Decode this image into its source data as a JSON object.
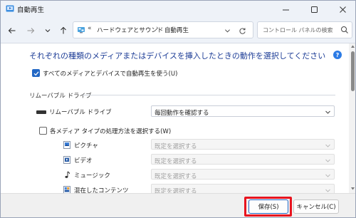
{
  "window": {
    "title": "自動再生",
    "controls": {
      "minimize_icon": "minimize-icon",
      "maximize_icon": "maximize-icon",
      "close_icon": "close-icon"
    }
  },
  "nav": {
    "back_icon": "arrow-left-icon",
    "forward_icon": "arrow-right-icon",
    "recent_icon": "chevron-down-icon",
    "up_icon": "arrow-up-icon",
    "address": {
      "separator": "«",
      "crumbs": [
        "ハードウェアとサウンド",
        "自動再生"
      ],
      "crumb_separator": "›"
    },
    "search": {
      "placeholder": "コントロール パネルの検索"
    }
  },
  "main": {
    "heading": "それぞれの種類のメディアまたはデバイスを挿入したときの動作を選択してください",
    "use_autoplay": {
      "label": "すべてのメディアとデバイスで自動再生を使う(U)",
      "checked": true
    },
    "removable_section": {
      "title": "リムーバブル ドライブ",
      "item_label": "リムーバブル ドライブ",
      "selected": "毎回動作を確認する"
    },
    "per_media": {
      "label": "各メディア タイプの処理方法を選択する(W)",
      "checked": false
    },
    "media_types": [
      {
        "label": "ピクチャ",
        "icon": "picture-icon",
        "selected": "既定を選択する"
      },
      {
        "label": "ビデオ",
        "icon": "video-icon",
        "selected": "既定を選択する"
      },
      {
        "label": "ミュージック",
        "icon": "music-icon",
        "selected": "既定を選択する"
      },
      {
        "label": "混在したコンテンツ",
        "icon": "mixed-content-icon",
        "selected": "既定を選択する"
      }
    ]
  },
  "footer": {
    "save_label": "保存(S)",
    "cancel_label": "キャンセル(C)"
  },
  "colors": {
    "accent": "#2368c5",
    "heading": "#1c3c96",
    "highlight": "#e8141f"
  }
}
